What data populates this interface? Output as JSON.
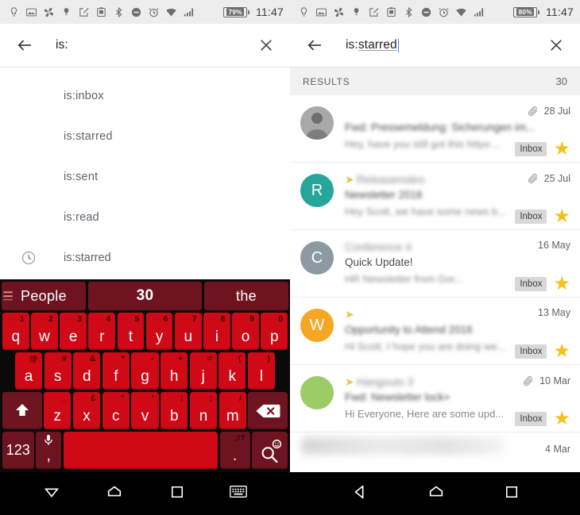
{
  "left": {
    "statusbar": {
      "icons": [
        "lightbulb-outline-icon",
        "image-icon",
        "pinwheel-icon",
        "lightbulb-icon",
        "note-edit-icon",
        "clipboard-icon",
        "bluetooth-icon",
        "do-not-disturb-icon",
        "alarm-icon",
        "wifi-icon",
        "signal-icon"
      ],
      "battery": "79%",
      "clock": "11:47"
    },
    "search": {
      "query": "is:",
      "query_plain": "is:",
      "query_spell": "",
      "back_label": "Back",
      "clear_label": "Clear"
    },
    "suggestions": [
      {
        "label": "is:inbox"
      },
      {
        "label": "is:starred"
      },
      {
        "label": "is:sent"
      },
      {
        "label": "is:read"
      },
      {
        "label": "is:starred",
        "history": true
      }
    ],
    "keyboard": {
      "suggestions": [
        "People",
        "30",
        "the"
      ],
      "row1": [
        {
          "key": "q",
          "alt": "1"
        },
        {
          "key": "w",
          "alt": "2"
        },
        {
          "key": "e",
          "alt": "3"
        },
        {
          "key": "r",
          "alt": "4"
        },
        {
          "key": "t",
          "alt": "5"
        },
        {
          "key": "y",
          "alt": "6"
        },
        {
          "key": "u",
          "alt": "7"
        },
        {
          "key": "i",
          "alt": "8"
        },
        {
          "key": "o",
          "alt": "9"
        },
        {
          "key": "p",
          "alt": "0"
        }
      ],
      "row2": [
        {
          "key": "a",
          "alt": "@"
        },
        {
          "key": "s",
          "alt": "#"
        },
        {
          "key": "d",
          "alt": "&"
        },
        {
          "key": "f",
          "alt": "*"
        },
        {
          "key": "g",
          "alt": "-"
        },
        {
          "key": "h",
          "alt": "+"
        },
        {
          "key": "j",
          "alt": "="
        },
        {
          "key": "k",
          "alt": "("
        },
        {
          "key": "l",
          "alt": ")"
        }
      ],
      "row3": [
        {
          "key": "z",
          "alt": "_"
        },
        {
          "key": "x",
          "alt": "£"
        },
        {
          "key": "c",
          "alt": "\""
        },
        {
          "key": "v",
          "alt": "'"
        },
        {
          "key": "b",
          "alt": ":"
        },
        {
          "key": "n",
          "alt": ";"
        },
        {
          "key": "m",
          "alt": "/"
        }
      ],
      "shift_label": "shift-key",
      "delete_label": "backspace-key",
      "num_label": "123",
      "comma_label": ",",
      "comma_alt": "mic-icon",
      "space_label": "",
      "period_label": ".",
      "period_alt": ",!?",
      "search_label": "search-key",
      "search_alt": "emoji-icon"
    },
    "navbar": [
      "dismiss-keyboard-icon",
      "home-icon",
      "recents-icon",
      "keyboard-switch-icon"
    ]
  },
  "right": {
    "statusbar": {
      "icons": [
        "lightbulb-outline-icon",
        "image-icon",
        "pinwheel-icon",
        "lightbulb-icon",
        "note-edit-icon",
        "clipboard-icon",
        "bluetooth-icon",
        "do-not-disturb-icon",
        "alarm-icon",
        "wifi-icon",
        "signal-icon"
      ],
      "battery": "80%",
      "clock": "11:47"
    },
    "search": {
      "query": "is:starred",
      "query_plain": "is:",
      "query_spell": "starred",
      "back_label": "Back",
      "clear_label": "Clear"
    },
    "results_header": {
      "label": "RESULTS",
      "count": "30"
    },
    "messages": [
      {
        "avatar_type": "photo",
        "avatar_letter": "",
        "avatar_color": "#9e9e9e",
        "sender": "",
        "sender_blurred": true,
        "subject": "Fwd: Pressemeldung: Sicherungen im...",
        "snippet": "Hey, have you still got this https:...",
        "date": "28 Jul",
        "attachment": true,
        "forwarded": false,
        "label": "Inbox",
        "starred": true
      },
      {
        "avatar_type": "letter",
        "avatar_letter": "R",
        "avatar_color": "#26a69a",
        "sender": "Releasenotes",
        "sender_blurred": true,
        "subject": "Newsletter 2016",
        "snippet": "Hey Scott, we have some news b...",
        "date": "25 Jul",
        "attachment": true,
        "forwarded": true,
        "label": "Inbox",
        "starred": true
      },
      {
        "avatar_type": "letter",
        "avatar_letter": "C",
        "avatar_color": "#8e9aa3",
        "sender": "Conference 4",
        "sender_blurred": true,
        "subject": "Quick Update!",
        "snippet": "HR Newsletter from Gor...",
        "date": "16 May",
        "attachment": false,
        "forwarded": false,
        "label": "Inbox",
        "starred": true
      },
      {
        "avatar_type": "letter",
        "avatar_letter": "W",
        "avatar_color": "#f5a623",
        "sender": "",
        "sender_blurred": true,
        "subject": "Opportunity to Attend 2016",
        "snippet": "Hi Scott, I hope you are doing we...",
        "date": "13 May",
        "attachment": false,
        "forwarded": true,
        "label": "Inbox",
        "starred": true
      },
      {
        "avatar_type": "letter",
        "avatar_letter": "",
        "avatar_color": "#9ccc65",
        "sender": "Hangouts 3",
        "sender_blurred": true,
        "subject": "Fwd: Newsletter lock+",
        "snippet": "Hi Everyone, Here are some upd...",
        "date": "10 Mar",
        "attachment": true,
        "forwarded": true,
        "label": "Inbox",
        "starred": true
      }
    ],
    "partial_message": {
      "date": "4 Mar"
    },
    "navbar": [
      "back-icon",
      "home-icon",
      "recents-icon"
    ]
  }
}
